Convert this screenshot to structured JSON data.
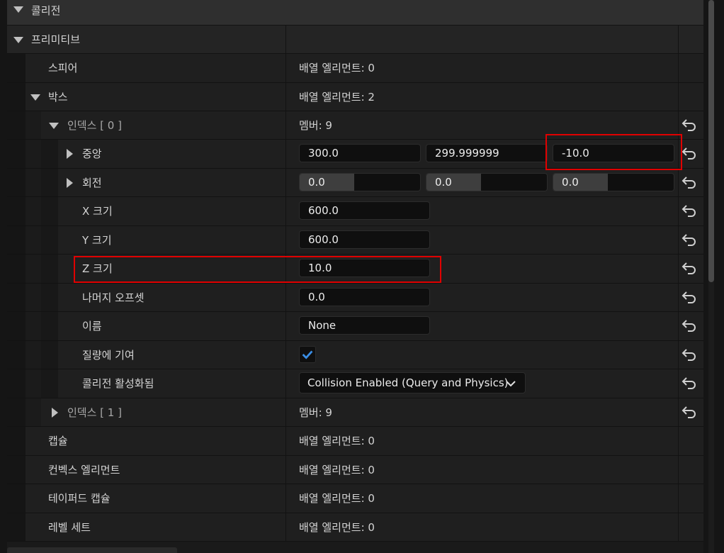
{
  "section": {
    "label": "콜리전"
  },
  "primitives": {
    "label": "프리미티브"
  },
  "rows": {
    "sphere": {
      "label": "스피어",
      "value": "배열 엘리먼트: 0"
    },
    "box": {
      "label": "박스",
      "value": "배열 엘리먼트: 2"
    },
    "index0": {
      "label": "인덱스 [ 0 ]",
      "value": "멤버: 9"
    },
    "center": {
      "label": "중앙",
      "x": "300.0",
      "y": "299.999999",
      "z": "-10.0"
    },
    "rotation": {
      "label": "회전",
      "x": "0.0",
      "y": "0.0",
      "z": "0.0",
      "x_fill": 0.45,
      "y_fill": 0.45,
      "z_fill": 0.45
    },
    "xsize": {
      "label": "X 크기",
      "value": "600.0"
    },
    "ysize": {
      "label": "Y 크기",
      "value": "600.0"
    },
    "zsize": {
      "label": "Z 크기",
      "value": "10.0"
    },
    "rest_offset": {
      "label": "나머지 오프셋",
      "value": "0.0"
    },
    "name": {
      "label": "이름",
      "value": "None"
    },
    "mass": {
      "label": "질량에 기여",
      "checked": true
    },
    "collision_enabled": {
      "label": "콜리전 활성화됨",
      "value": "Collision Enabled (Query and Physics)"
    },
    "index1": {
      "label": "인덱스 [ 1 ]",
      "value": "멤버: 9"
    },
    "capsule": {
      "label": "캡슐",
      "value": "배열 엘리먼트: 0"
    },
    "convex": {
      "label": "컨벡스 엘리먼트",
      "value": "배열 엘리먼트: 0"
    },
    "tapered": {
      "label": "테이퍼드 캡슐",
      "value": "배열 엘리먼트: 0"
    },
    "level_set": {
      "label": "레벨 세트",
      "value": "배열 엘리먼트: 0"
    }
  },
  "icons": {
    "reset": "reset-arrow-icon",
    "expand": "triangle-down-icon",
    "collapse": "triangle-right-icon",
    "check": "checkmark-icon",
    "dropdown": "chevron-down-icon"
  },
  "colors": {
    "highlight": "#e00000",
    "check": "#3a8ee6"
  }
}
